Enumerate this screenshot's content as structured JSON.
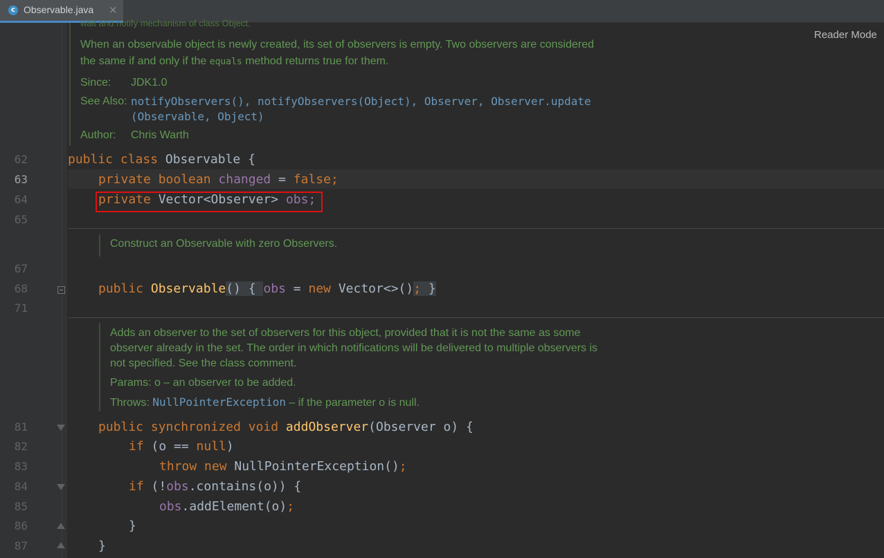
{
  "tab": {
    "icon_letter": "c",
    "filename": "Observable.java",
    "close": "×"
  },
  "reader_mode": "Reader Mode",
  "doc_top": {
    "partial": "wait and notify mechanism of class Object.",
    "para": [
      "When an observable object is newly created, its set of observers is empty. Two observers are considered",
      "the same if and only if the ",
      "equals",
      " method returns true for them."
    ],
    "since_label": "Since:",
    "since_value": "JDK1.0",
    "see_also_label": "See Also:",
    "see_also_links": [
      "notifyObservers()",
      "notifyObservers(Object)",
      "Observer",
      "Observer.update",
      "(Observable, Object)"
    ],
    "author_label": "Author:",
    "author_value": "Chris Warth"
  },
  "doc_ctor": "Construct an Observable with zero Observers.",
  "doc_add": {
    "lines": [
      "Adds an observer to the set of observers for this object, provided that it is not the same as some",
      "observer already in the set. The order in which notifications will be delivered to multiple observers is",
      "not specified. See the class comment."
    ],
    "params_label": "Params:",
    "params_value": "o – an observer to be added.",
    "throws_label": "Throws:",
    "throws_link": "NullPointerException",
    "throws_value": " – if the parameter o is null."
  },
  "line_numbers": [
    "62",
    "63",
    "64",
    "65",
    "67",
    "68",
    "71",
    "81",
    "82",
    "83",
    "84",
    "85",
    "86",
    "87"
  ],
  "code": {
    "l62": [
      "public class",
      " Observable {"
    ],
    "l63": [
      "private boolean",
      " changed",
      " = ",
      "false;"
    ],
    "l64": [
      "private",
      " Vector<Observer> ",
      "obs;"
    ],
    "l68": [
      "public",
      "Observable",
      "()",
      " { ",
      "obs",
      " = ",
      "new",
      " Vector<>()",
      ";",
      " }"
    ],
    "l81": [
      "public synchronized void",
      " addObserver",
      "(Observer o) {"
    ],
    "l82": [
      "if",
      " (o == ",
      "null",
      ")"
    ],
    "l83": [
      "throw new",
      " NullPointerException()",
      ";"
    ],
    "l84": [
      "if",
      " (!",
      "obs",
      ".contains(o)) {"
    ],
    "l85": [
      "obs",
      ".addElement(o)",
      ";"
    ],
    "l86": [
      "}"
    ],
    "l87": [
      "}"
    ]
  },
  "colors": {
    "keyword": "#cc7832",
    "field": "#9876aa",
    "method": "#ffc66d",
    "doc": "#629755",
    "link": "#6897bb",
    "highlight_box": "#e01010"
  }
}
